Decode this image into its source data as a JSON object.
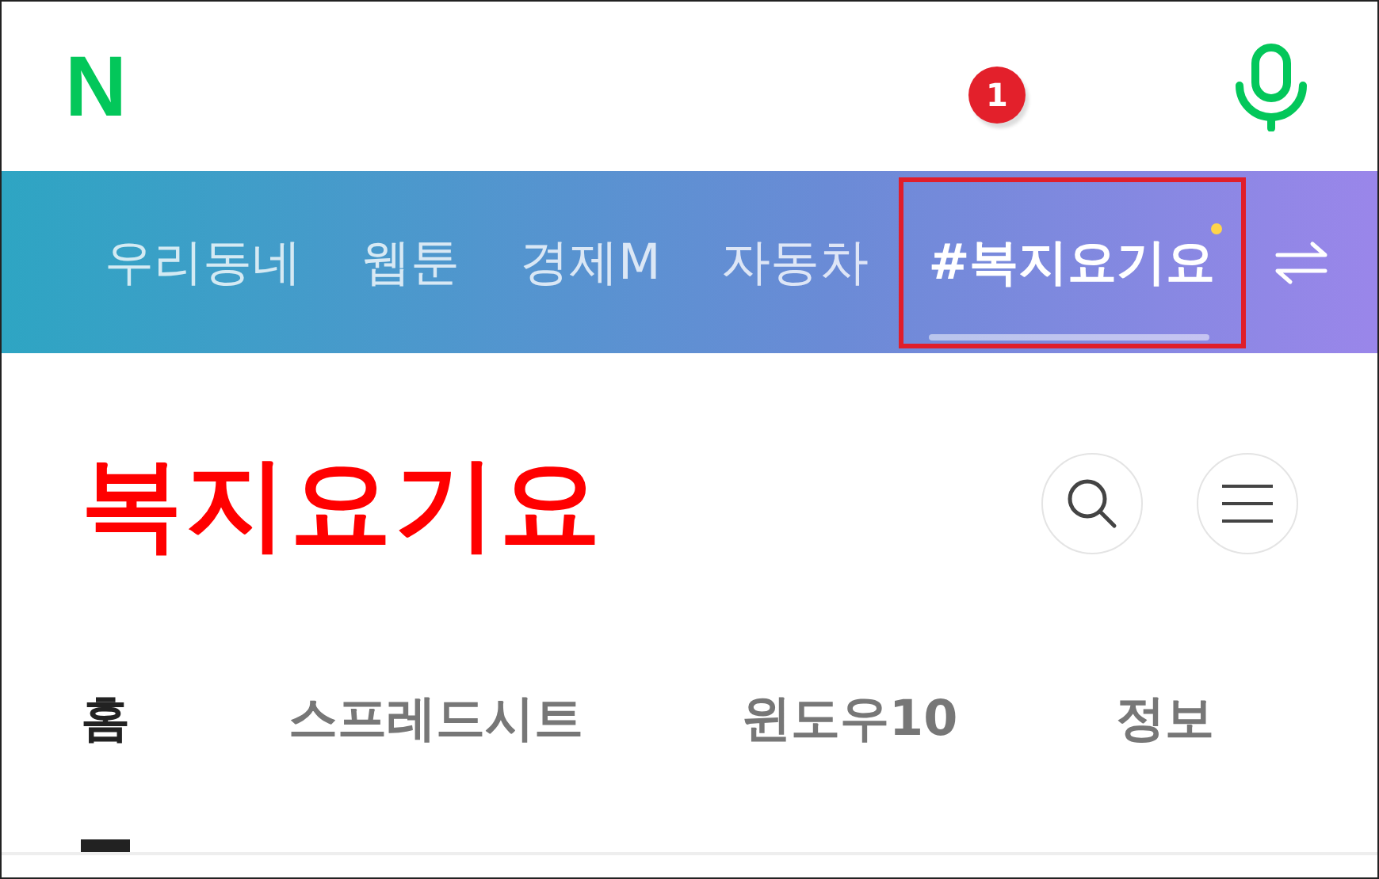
{
  "header": {
    "logo": "N",
    "notification_count": "1"
  },
  "nav": {
    "items": [
      {
        "label": "우리동네",
        "selected": false,
        "new": false,
        "highlighted": false
      },
      {
        "label": "웹툰",
        "selected": false,
        "new": false,
        "highlighted": false
      },
      {
        "label": "경제M",
        "selected": false,
        "new": false,
        "highlighted": false
      },
      {
        "label": "자동차",
        "selected": false,
        "new": false,
        "highlighted": false
      },
      {
        "label": "#복지요기요",
        "selected": true,
        "new": true,
        "highlighted": true
      }
    ]
  },
  "blog": {
    "title": "복지요기요"
  },
  "tabs": [
    {
      "label": "홈",
      "selected": true
    },
    {
      "label": "스프레드시트",
      "selected": false
    },
    {
      "label": "윈도우10",
      "selected": false
    },
    {
      "label": "정보",
      "selected": false
    }
  ]
}
